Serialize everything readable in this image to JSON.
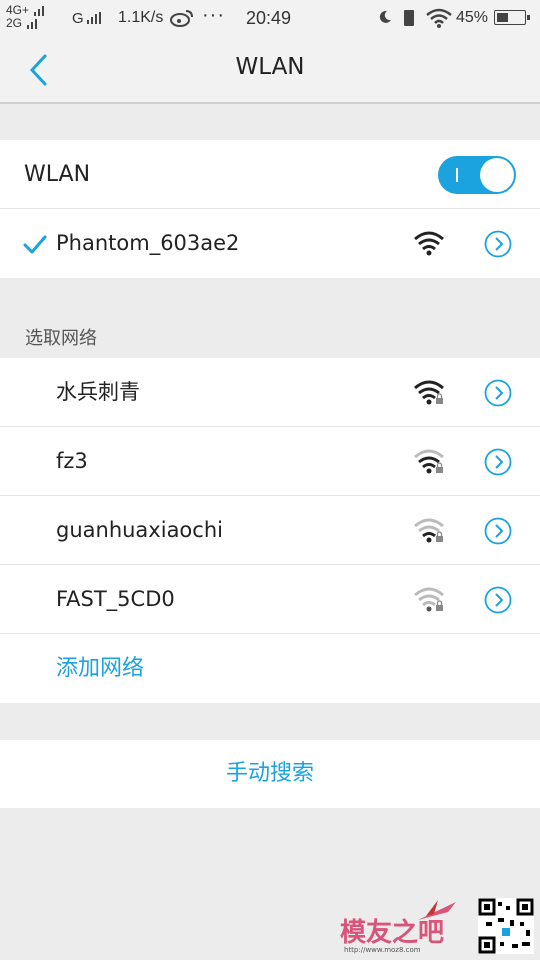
{
  "status_bar": {
    "net1": "4G+",
    "net2": "2G",
    "net3": "G",
    "speed": "1.1K/s",
    "dots": "···",
    "time": "20:49",
    "battery_percent": "45%",
    "battery_level": 0.45
  },
  "header": {
    "title": "WLAN"
  },
  "wlan_toggle": {
    "label": "WLAN",
    "on": true
  },
  "connected_network": {
    "ssid": "Phantom_603ae2",
    "signal_icon": "wifi-full-icon"
  },
  "available_section": {
    "title": "选取网络",
    "networks": [
      {
        "ssid": "水兵刺青",
        "signal": "strong",
        "secured": true
      },
      {
        "ssid": "fz3",
        "signal": "strong",
        "secured": true
      },
      {
        "ssid": "guanhuaxiaochi",
        "signal": "medium",
        "secured": true
      },
      {
        "ssid": "FAST_5CD0",
        "signal": "weak",
        "secured": true
      }
    ],
    "add_label": "添加网络"
  },
  "manual_search_label": "手动搜索",
  "watermark": {
    "text": "模友之吧",
    "url": "http://www.moz8.com"
  },
  "colors": {
    "accent": "#1aa3df",
    "background": "#ececec"
  }
}
